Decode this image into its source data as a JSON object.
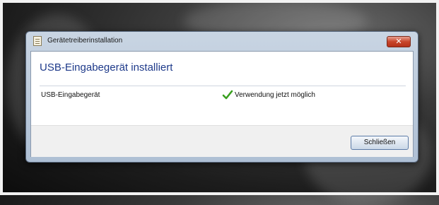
{
  "window": {
    "title": "Gerätetreiberinstallation",
    "close_glyph": "✕"
  },
  "content": {
    "heading": "USB-Eingabegerät installiert",
    "device_name": "USB-Eingabegerät",
    "status_text": "Verwendung jetzt möglich",
    "status_icon": "check-icon",
    "status_color": "#3aa020"
  },
  "footer": {
    "close_label": "Schließen"
  }
}
